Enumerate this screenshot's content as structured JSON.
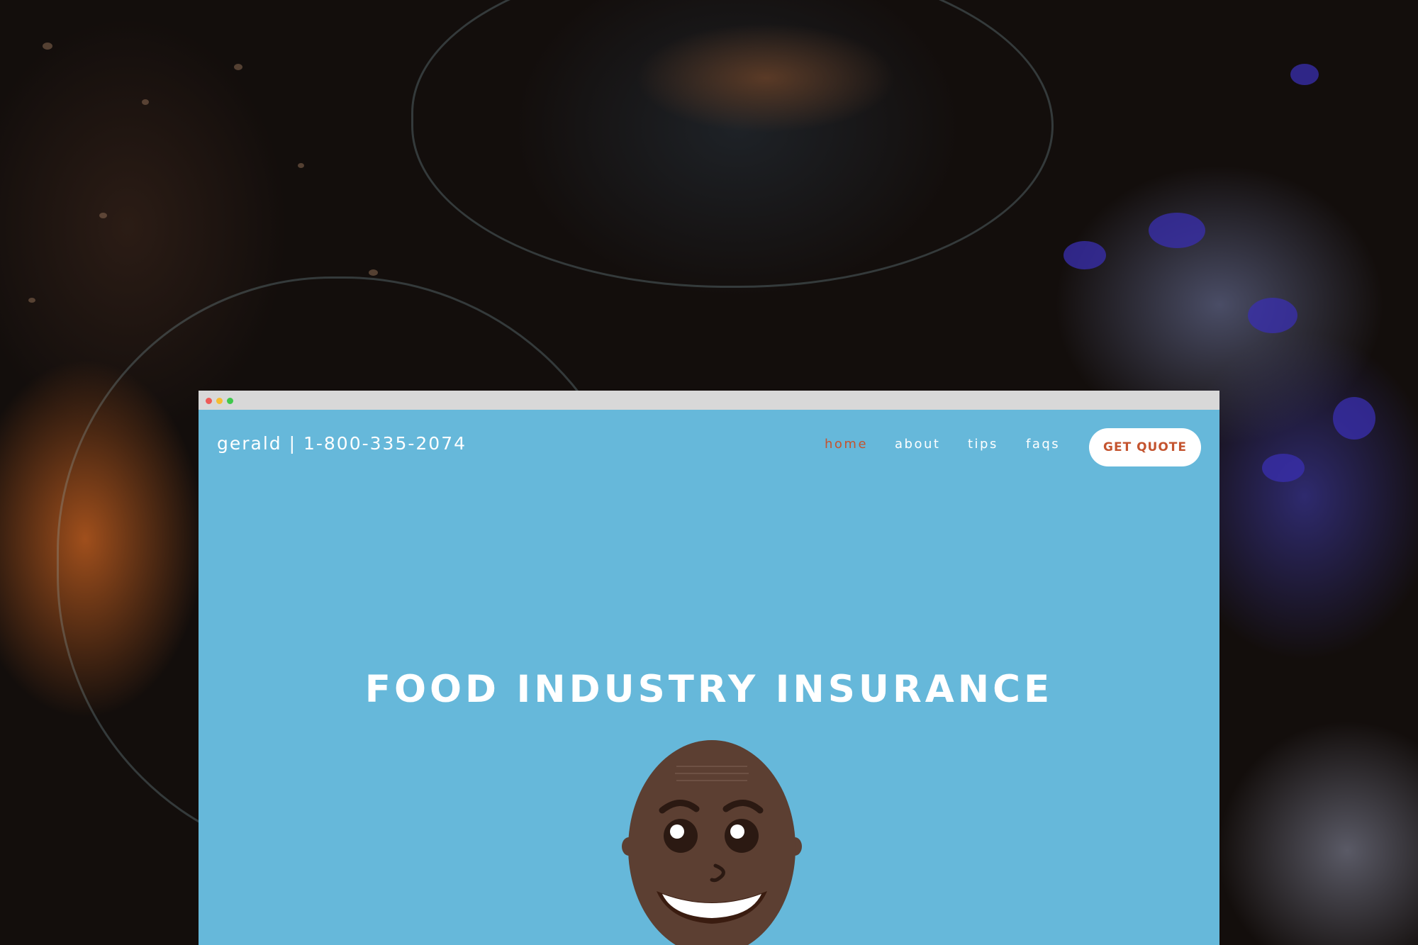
{
  "brand": {
    "text": "gerald | 1-800-335-2074"
  },
  "nav": {
    "items": [
      {
        "label": "home",
        "active": true
      },
      {
        "label": "about",
        "active": false
      },
      {
        "label": "tips",
        "active": false
      },
      {
        "label": "faqs",
        "active": false
      }
    ],
    "cta_label": "GET QUOTE"
  },
  "hero": {
    "title": "FOOD INDUSTRY INSURANCE"
  },
  "colors": {
    "hero_background": "#66b8da",
    "accent": "#c4542f",
    "text": "#ffffff",
    "titlebar": "#d8d8d8"
  },
  "icons": [
    "window-close-dot",
    "window-minimize-dot",
    "window-maximize-dot",
    "character-avatar"
  ]
}
